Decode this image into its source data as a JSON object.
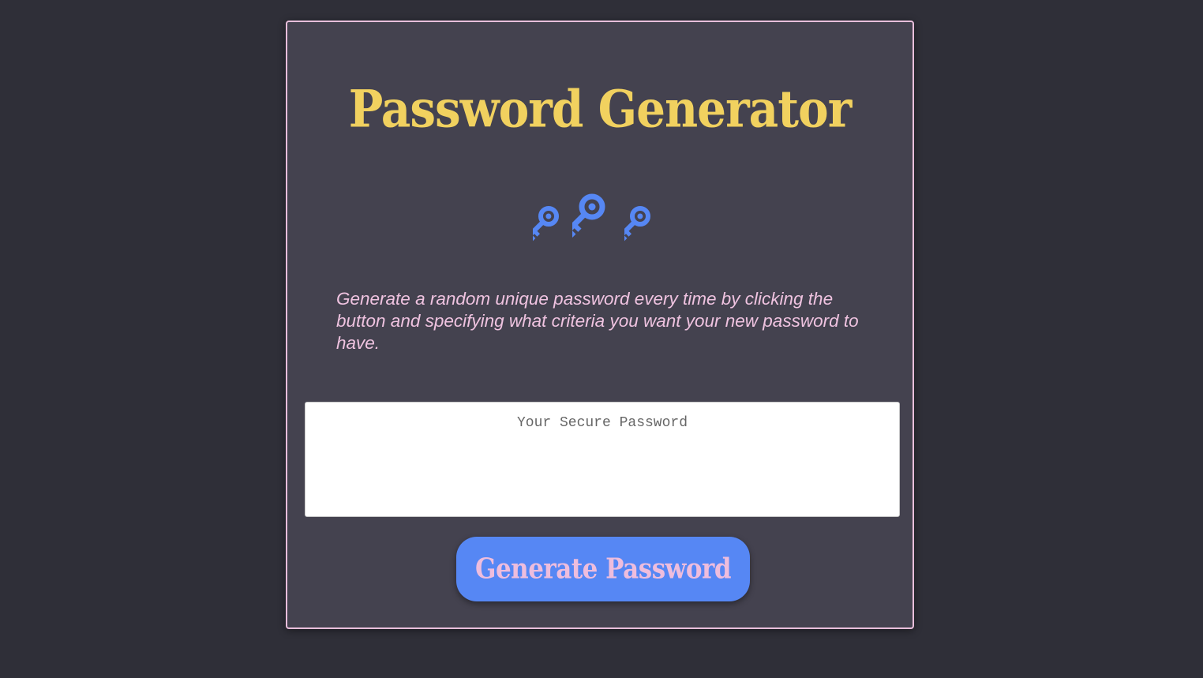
{
  "app": {
    "title": "Password Generator",
    "description": "Generate a random unique password every time by clicking the button and specifying what criteria you want your new password to have."
  },
  "icons": [
    "key-icon",
    "key-icon",
    "key-icon"
  ],
  "output": {
    "placeholder": "Your Secure Password",
    "value": ""
  },
  "generate_button": {
    "label": "Generate Password"
  },
  "colors": {
    "background": "#2f2f38",
    "card": "#44424f",
    "card_border": "#e8bedb",
    "title": "#f1d15f",
    "description": "#efc3e0",
    "icon": "#5687f4",
    "button": "#5687f4",
    "button_text": "#eebddd"
  }
}
